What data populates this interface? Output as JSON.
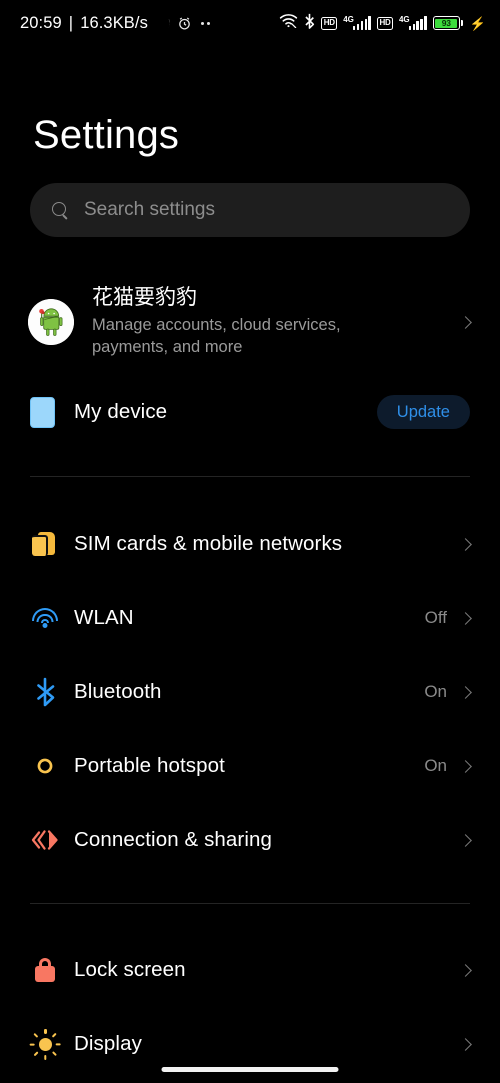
{
  "status_bar": {
    "clock": "20:59",
    "separator": "|",
    "network_speed": "16.3KB/s",
    "dnd_icon": "crescent-moon-icon",
    "alarm_icon": "alarm-clock-icon",
    "more_icon": "two-dots-icon",
    "wifi_icon": "wifi-slash-icon",
    "bluetooth_icon": "bluetooth-icon",
    "sim1_hd_label": "HD",
    "sim1_network_label": "4G",
    "sim2_hd_label": "HD",
    "sim2_network_label": "4G",
    "battery_level": "93",
    "charging_icon": "lightning-bolt-icon"
  },
  "header": {
    "title": "Settings"
  },
  "search": {
    "placeholder": "Search settings",
    "icon": "search-icon"
  },
  "account": {
    "name": "花猫要豹豹",
    "subtitle": "Manage accounts, cloud services, payments, and more",
    "avatar_icon": "android-robot-avatar",
    "chevron": "chevron-right-icon"
  },
  "device": {
    "label": "My device",
    "icon": "phone-icon",
    "action_label": "Update",
    "accent_color": "#2f8fe8",
    "button_bg": "#0d1b2c"
  },
  "groups": [
    {
      "name": "connectivity",
      "items": [
        {
          "label": "SIM cards & mobile networks",
          "value": "",
          "icon": "sim-card-icon",
          "icon_color": "#f9c44f",
          "chevron": "chevron-right-icon"
        },
        {
          "label": "WLAN",
          "value": "Off",
          "icon": "wifi-icon",
          "icon_color": "#2f9bf5",
          "chevron": "chevron-right-icon"
        },
        {
          "label": "Bluetooth",
          "value": "On",
          "icon": "bluetooth-icon",
          "icon_color": "#2f9bf5",
          "chevron": "chevron-right-icon"
        },
        {
          "label": "Portable hotspot",
          "value": "On",
          "icon": "hotspot-icon",
          "icon_color": "#f9c44f",
          "chevron": "chevron-right-icon"
        },
        {
          "label": "Connection & sharing",
          "value": "",
          "icon": "connection-sharing-icon",
          "icon_color": "#f87762",
          "chevron": "chevron-right-icon"
        }
      ]
    },
    {
      "name": "personalization",
      "items": [
        {
          "label": "Lock screen",
          "value": "",
          "icon": "lock-icon",
          "icon_color": "#f87762",
          "chevron": "chevron-right-icon"
        },
        {
          "label": "Display",
          "value": "",
          "icon": "brightness-sun-icon",
          "icon_color": "#f9c44f",
          "chevron": "chevron-right-icon"
        }
      ]
    }
  ],
  "nav": {
    "gesture_bar": "home-gesture-bar"
  }
}
